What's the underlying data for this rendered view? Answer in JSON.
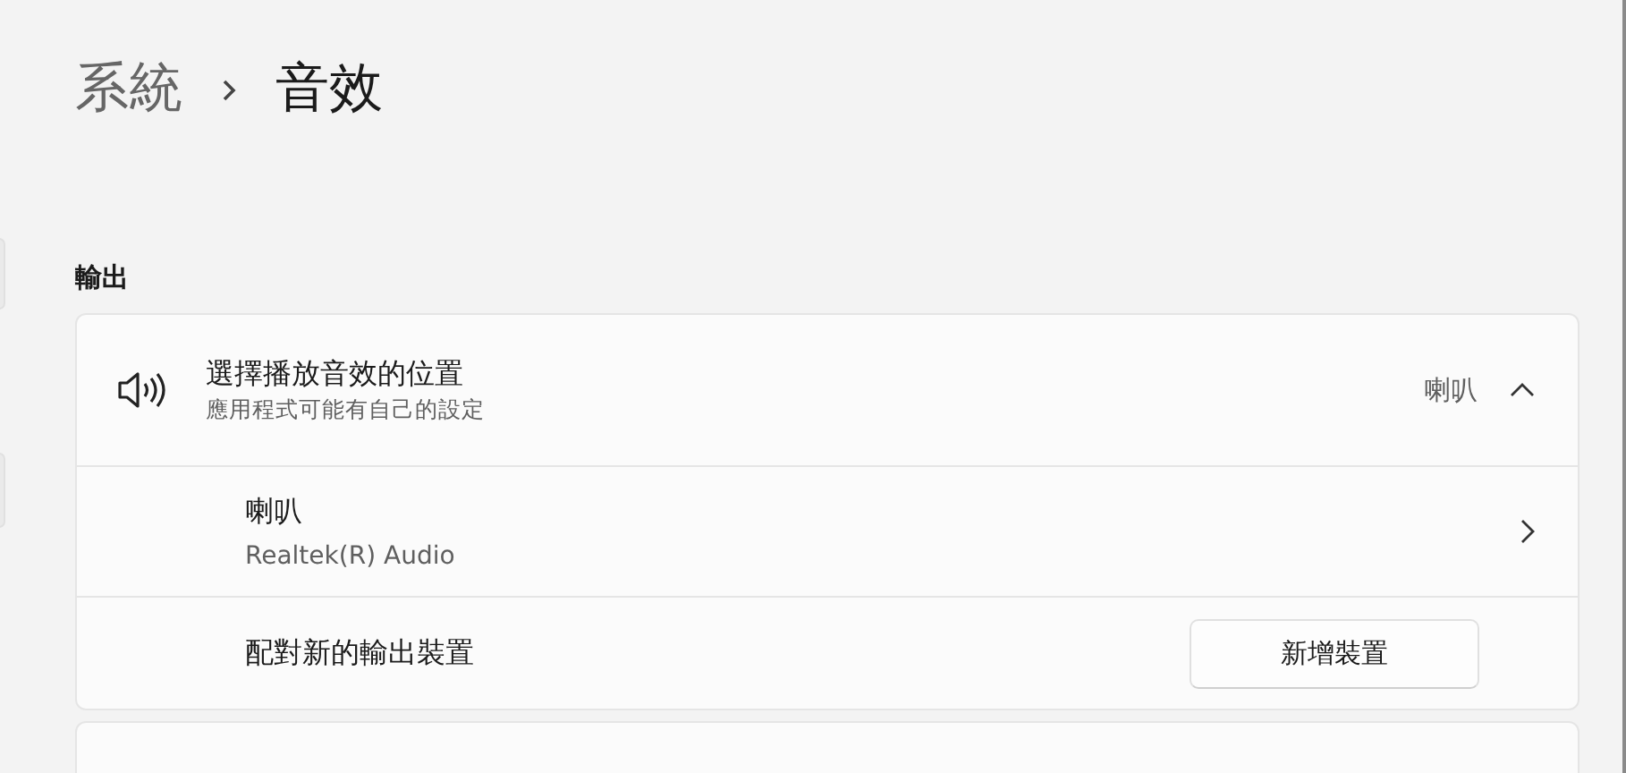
{
  "breadcrumb": [
    {
      "label": "系統",
      "current": false
    },
    {
      "label": "音效",
      "current": true
    }
  ],
  "section": {
    "title": "輸出"
  },
  "output_card": {
    "header": {
      "title": "選擇播放音效的位置",
      "subtitle": "應用程式可能有自己的設定",
      "value": "喇叭",
      "expanded": true
    },
    "devices": [
      {
        "name": "喇叭",
        "detail": "Realtek(R) Audio"
      }
    ],
    "pair_row": {
      "label": "配對新的輸出裝置",
      "button": "新增裝置"
    }
  }
}
